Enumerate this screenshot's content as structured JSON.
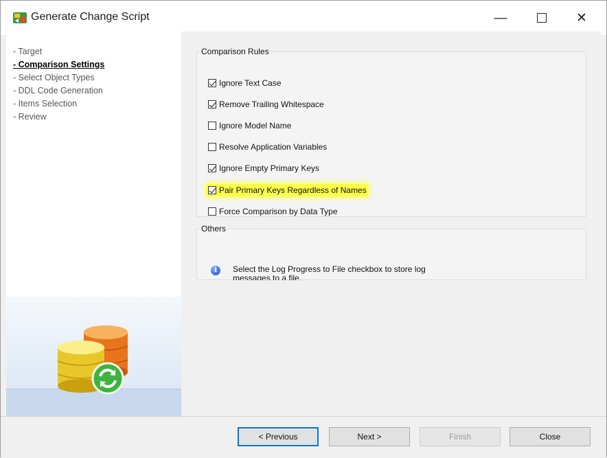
{
  "window": {
    "title": "Generate Change Script"
  },
  "nav": {
    "items": [
      {
        "label": "- Target",
        "active": false
      },
      {
        "label": "- Comparison Settings",
        "active": true
      },
      {
        "label": "- Select Object Types",
        "active": false
      },
      {
        "label": "- DDL Code Generation",
        "active": false
      },
      {
        "label": "- Items Selection",
        "active": false
      },
      {
        "label": "- Review",
        "active": false
      }
    ]
  },
  "comparison_rules": {
    "legend": "Comparison Rules",
    "options": [
      {
        "label": "Ignore Text Case",
        "checked": true,
        "highlighted": false
      },
      {
        "label": "Remove Trailing Whitespace",
        "checked": true,
        "highlighted": false
      },
      {
        "label": "Ignore Model Name",
        "checked": false,
        "highlighted": false
      },
      {
        "label": "Resolve Application Variables",
        "checked": false,
        "highlighted": false
      },
      {
        "label": "Ignore Empty Primary Keys",
        "checked": true,
        "highlighted": false
      },
      {
        "label": "Pair Primary Keys Regardless of Names",
        "checked": true,
        "highlighted": true
      },
      {
        "label": "Force Comparison by Data Type",
        "checked": false,
        "highlighted": false
      }
    ]
  },
  "others": {
    "legend": "Others",
    "info_text": "Select the Log Progress to File checkbox to store log messages to a file.",
    "info_icon": "info-icon"
  },
  "buttons": {
    "previous": "< Previous",
    "next": "Next >",
    "finish": "Finish",
    "close": "Close"
  },
  "colors": {
    "highlight": "#fbff4a",
    "primary_border": "#0078d7"
  }
}
